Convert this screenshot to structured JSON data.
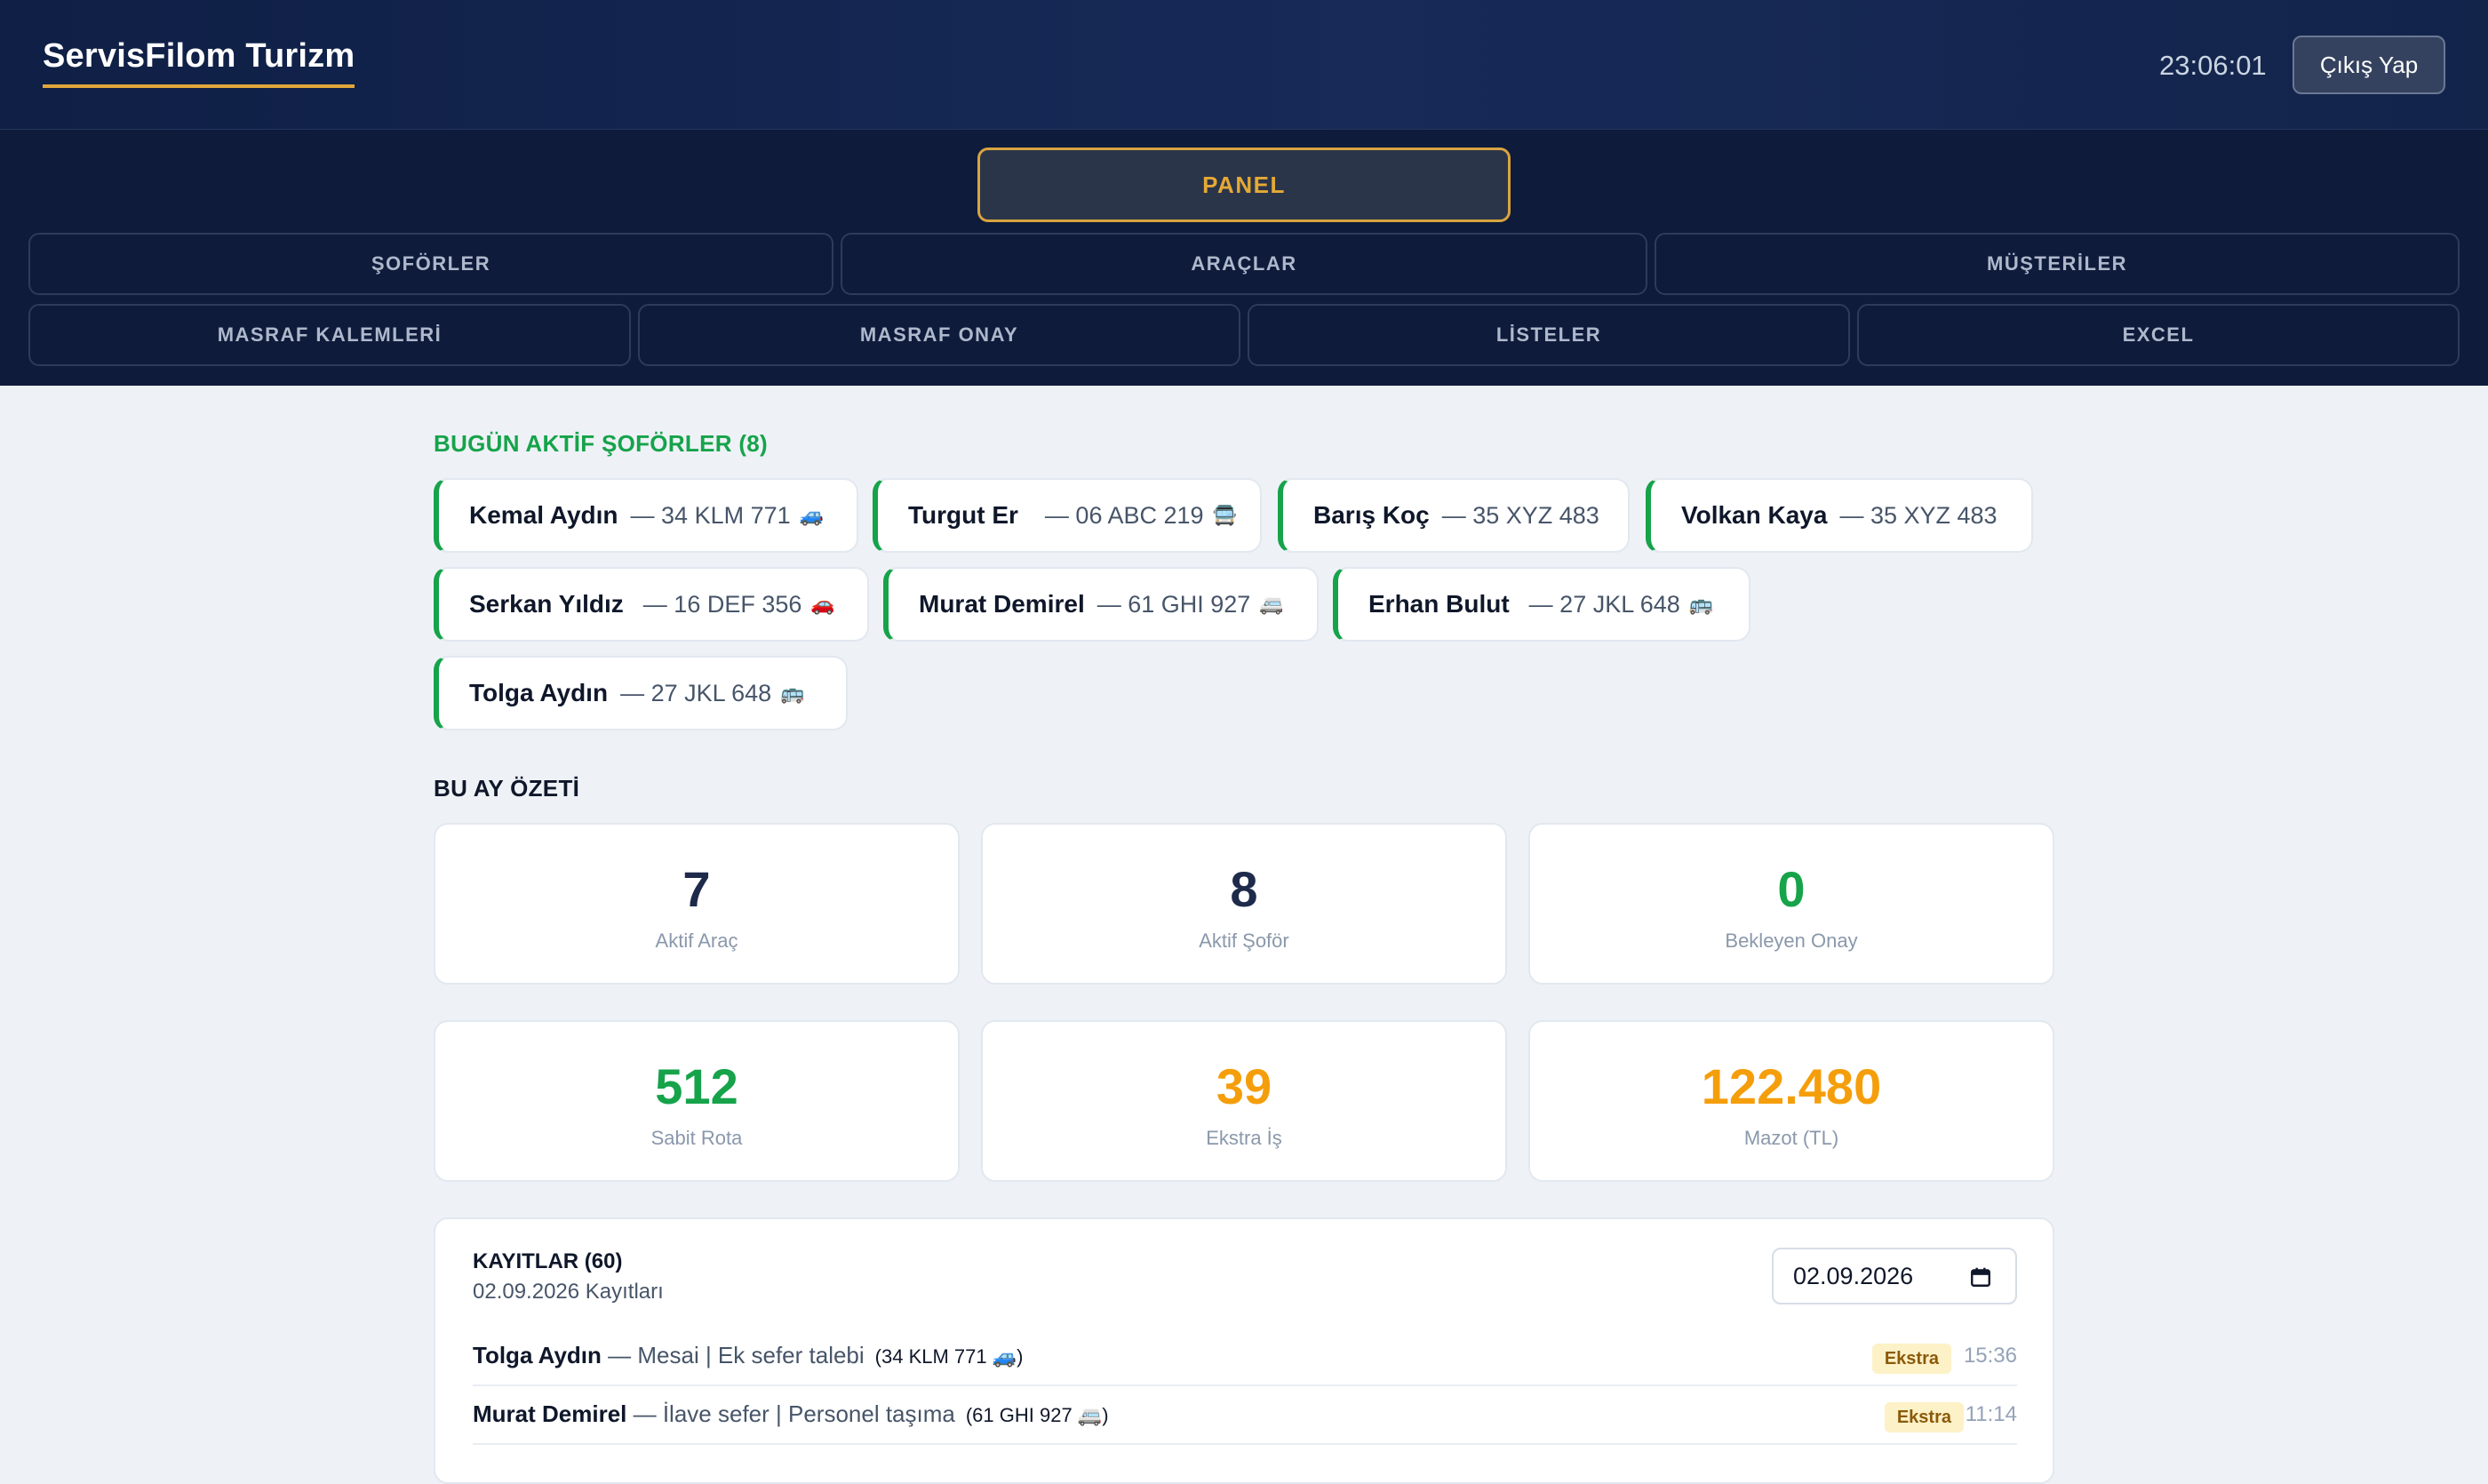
{
  "app": {
    "title": "ServisFilom Turizm",
    "clock": "23:06:01",
    "logout_label": "Çıkış Yap"
  },
  "nav": {
    "panel": "PANEL",
    "row1": [
      "ŞOFÖRLER",
      "ARAÇLAR",
      "MÜŞTERİLER"
    ],
    "row2": [
      "MASRAF KALEMLERİ",
      "MASRAF ONAY",
      "LİSTELER",
      "EXCEL"
    ]
  },
  "active_drivers": {
    "title": "BUGÜN AKTİF ŞOFÖRLER (8)",
    "items": [
      {
        "name": "Kemal Aydın",
        "plate": "— 34 KLM 771",
        "icon": "🚙"
      },
      {
        "name": "Turgut Er",
        "plate": "— 06 ABC 219",
        "icon": "🚍"
      },
      {
        "name": "Barış Koç",
        "plate": "— 35 XYZ 483",
        "icon": ""
      },
      {
        "name": "Volkan Kaya",
        "plate": "— 35 XYZ 483",
        "icon": ""
      },
      {
        "name": "Serkan Yıldız",
        "plate": "— 16 DEF 356",
        "icon": "🚗"
      },
      {
        "name": "Murat Demirel",
        "plate": "— 61 GHI 927",
        "icon": "🚐"
      },
      {
        "name": "Erhan Bulut",
        "plate": "— 27 JKL 648",
        "icon": "🚌"
      },
      {
        "name": "Tolga Aydın",
        "plate": "— 27 JKL 648",
        "icon": "🚌"
      }
    ]
  },
  "summary": {
    "title": "BU AY ÖZETİ",
    "stats": [
      {
        "value": "7",
        "label": "Aktif Araç",
        "color": "#1e2a4a"
      },
      {
        "value": "8",
        "label": "Aktif Şoför",
        "color": "#1e2a4a"
      },
      {
        "value": "0",
        "label": "Bekleyen Onay",
        "color": "#16a34a"
      },
      {
        "value": "512",
        "label": "Sabit Rota",
        "color": "#16a34a"
      },
      {
        "value": "39",
        "label": "Ekstra İş",
        "color": "#f59e0b"
      },
      {
        "value": "122.480",
        "label": "Mazot (TL)",
        "color": "#f59e0b"
      }
    ]
  },
  "records": {
    "title": "KAYITLAR (60)",
    "subtitle": "02.09.2026 Kayıtları",
    "date_value": "02.09.2026",
    "rows": [
      {
        "name": "Tolga Aydın",
        "detail": " — Mesai | Ek sefer talebi",
        "plate": "(34 KLM 771 🚙)",
        "badge": "Ekstra",
        "time": "15:36"
      },
      {
        "name": "Murat Demirel",
        "detail": " — İlave sefer | Personel taşıma",
        "plate": "(61 GHI 927 🚐)",
        "badge": "Ekstra",
        "time": "11:14"
      }
    ]
  }
}
